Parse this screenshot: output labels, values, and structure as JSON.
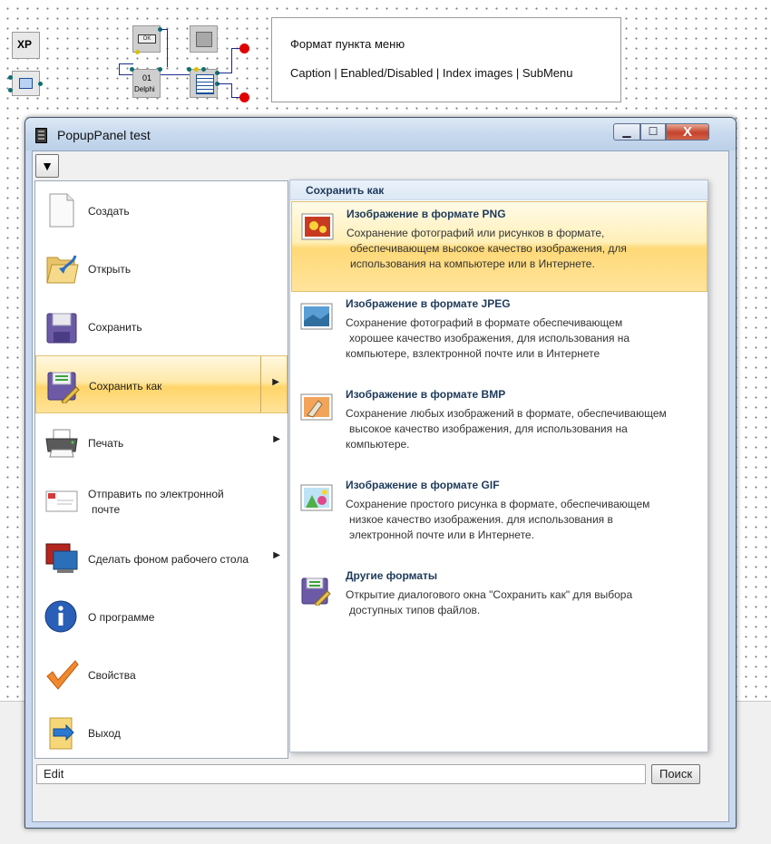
{
  "designer": {
    "xp_label": "XP",
    "ok_label": "OK",
    "delphi_label": "Delphi",
    "note_line1": "Формат пункта меню",
    "note_line2": "Caption | Enabled/Disabled | Index images | SubMenu"
  },
  "window": {
    "title": "PopupPanel test",
    "minimize_label": "▁",
    "maximize_label": "☐",
    "close_label": "X",
    "dropdown_label": "▼"
  },
  "menu": {
    "items": [
      {
        "label": "Создать",
        "icon": "new-document-icon",
        "submenu": false
      },
      {
        "label": "Открыть",
        "icon": "open-folder-icon",
        "submenu": false
      },
      {
        "label": "Сохранить",
        "icon": "save-disk-icon",
        "submenu": false
      },
      {
        "label": "Сохранить как",
        "icon": "save-as-icon",
        "submenu": true,
        "active": true
      },
      {
        "label": "Печать",
        "icon": "printer-icon",
        "submenu": true
      },
      {
        "label_line1": "Отправить по электронной",
        "label_line2": "почте",
        "icon": "email-icon",
        "submenu": false
      },
      {
        "label": "Сделать фоном рабочего стола",
        "icon": "desktop-icon",
        "submenu": true
      },
      {
        "label": "О программе",
        "icon": "info-icon",
        "submenu": false
      },
      {
        "label": "Свойства",
        "icon": "checkmark-icon",
        "submenu": false
      },
      {
        "label": "Выход",
        "icon": "exit-icon",
        "submenu": false
      }
    ],
    "arrow": "▶"
  },
  "submenu": {
    "header": "Сохранить как",
    "items": [
      {
        "title": "Изображение в формате PNG",
        "desc": [
          "Сохранение фотографий или рисунков в формате,",
          "обеспечивающем высокое качество изображения, для",
          "использования на компьютере или в Интернете."
        ],
        "icon": "png-image-icon"
      },
      {
        "title": "Изображение в формате JPEG",
        "desc": [
          "Сохранение фотографий в формате обеспечивающем",
          "хорошее качество изображения, для использования на",
          "компьютере, взлектронной почте или в Интернете"
        ],
        "icon": "jpeg-image-icon"
      },
      {
        "title": "Изображение в формате BMP",
        "desc": [
          "Сохранение любых изображений в формате, обеспечивающем",
          "высокое качество изображения, для использования на",
          "компьютере."
        ],
        "icon": "bmp-image-icon"
      },
      {
        "title": "Изображение в формате GIF",
        "desc": [
          "Сохранение простого рисунка в формате, обеспечивающем",
          "низкое качество изображения. для использования в",
          "электронной почте или в Интернете."
        ],
        "icon": "gif-image-icon"
      },
      {
        "title": "Другие форматы",
        "desc": [
          "Открытие диалогового окна \"Сохранить как\" для выбора",
          "доступных типов файлов."
        ],
        "icon": "other-formats-icon"
      }
    ]
  },
  "search": {
    "edit_value": "Edit",
    "button_label": "Поиск"
  },
  "colors": {
    "highlight": "#ffd56a",
    "title_text": "#1e3a5a",
    "close_button": "#c6422b"
  }
}
